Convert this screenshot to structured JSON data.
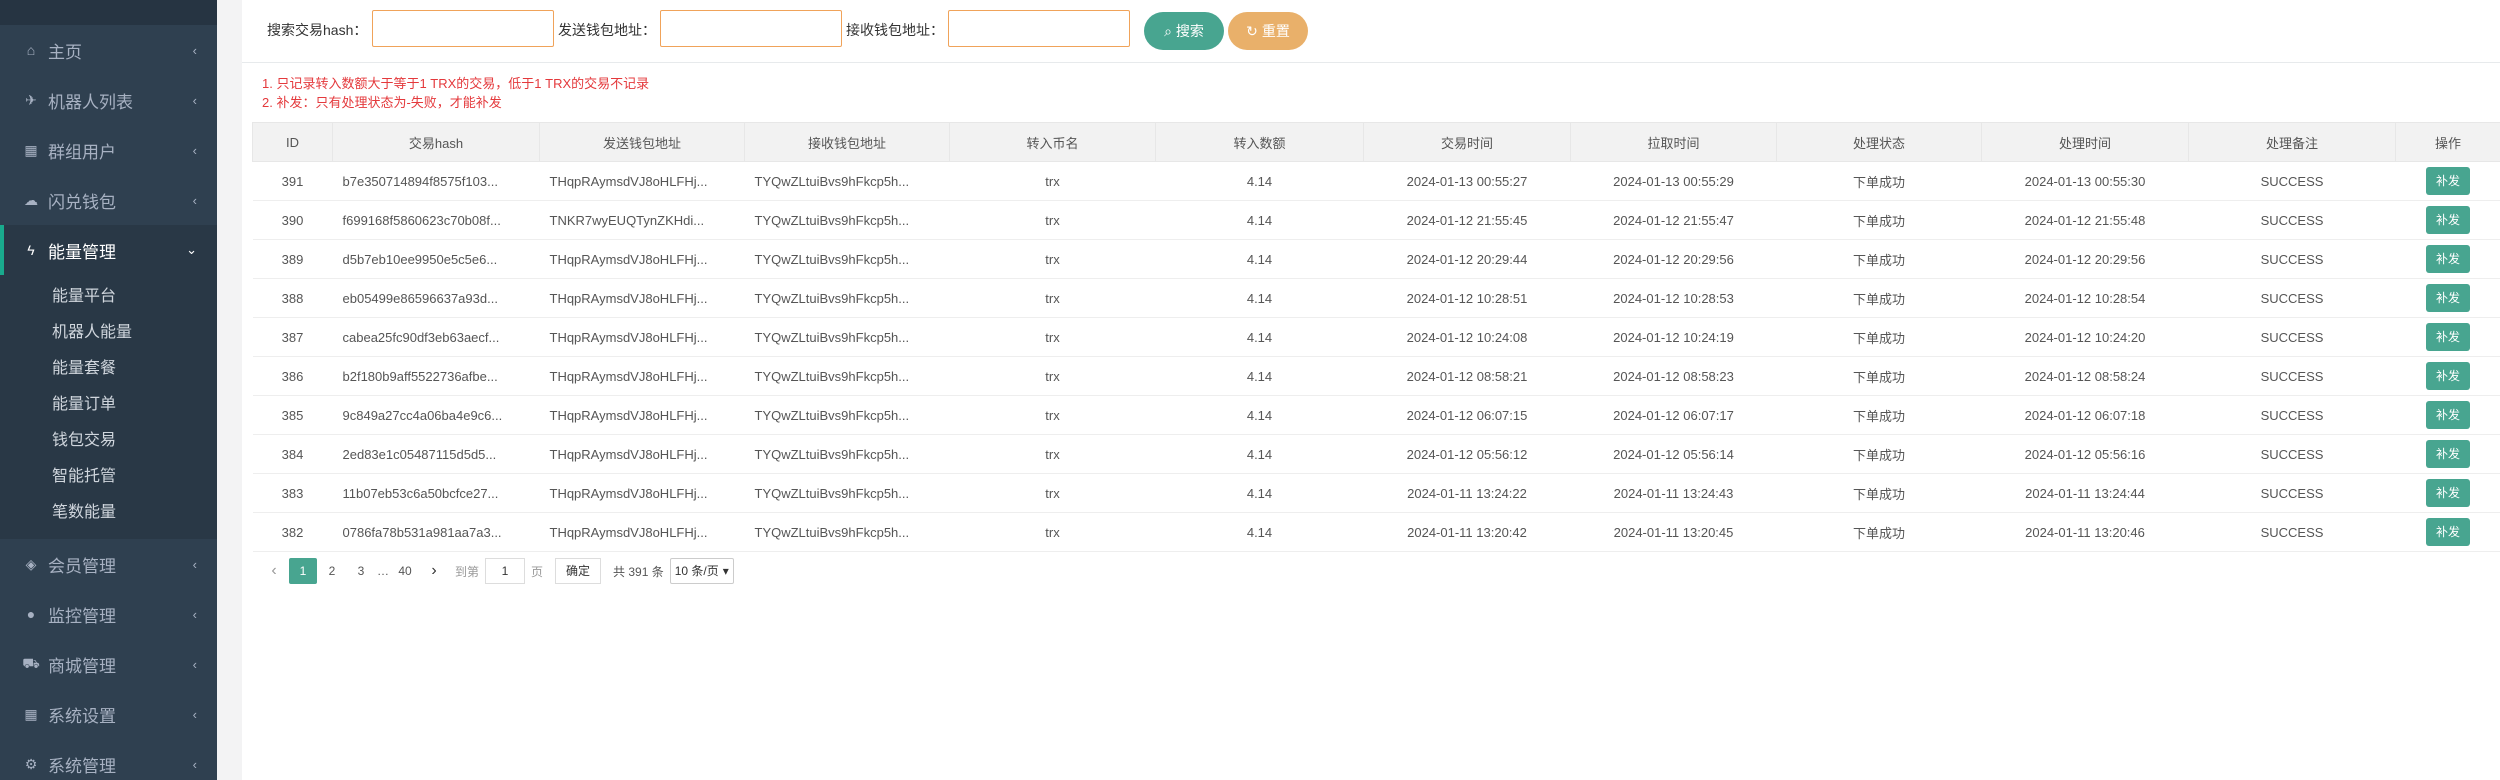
{
  "sidebar": {
    "items": [
      {
        "label": "主页",
        "icon": "home-icon",
        "glyph": "⌂",
        "active": false
      },
      {
        "label": "机器人列表",
        "icon": "plane-icon",
        "glyph": "✈",
        "active": false
      },
      {
        "label": "群组用户",
        "icon": "group-icon",
        "glyph": "▦",
        "active": false
      },
      {
        "label": "闪兑钱包",
        "icon": "cloud-icon",
        "glyph": "☁",
        "active": false
      },
      {
        "label": "能量管理",
        "icon": "bolt-icon",
        "glyph": "ϟ",
        "active": true
      }
    ],
    "sub_items": [
      "能量平台",
      "机器人能量",
      "能量套餐",
      "能量订单",
      "钱包交易",
      "智能托管",
      "笔数能量"
    ],
    "items_after": [
      {
        "label": "会员管理",
        "icon": "diamond-icon",
        "glyph": "◈"
      },
      {
        "label": "监控管理",
        "icon": "shield-icon",
        "glyph": "●"
      },
      {
        "label": "商城管理",
        "icon": "cart-icon",
        "glyph": "⛟"
      },
      {
        "label": "系统设置",
        "icon": "windows-icon",
        "glyph": "▦"
      },
      {
        "label": "系统管理",
        "icon": "gear-icon",
        "glyph": "⚙"
      }
    ]
  },
  "search": {
    "hash_label": "搜索交易hash：",
    "from_label": "发送钱包地址：",
    "to_label": "接收钱包地址：",
    "search_button": "搜索",
    "reset_button": "重置"
  },
  "notes": [
    "1. 只记录转入数额大于等于1 TRX的交易，低于1 TRX的交易不记录",
    "2. 补发：只有处理状态为-失败，才能补发"
  ],
  "table": {
    "headers": [
      "ID",
      "交易hash",
      "发送钱包地址",
      "接收钱包地址",
      "转入币名",
      "转入数额",
      "交易时间",
      "拉取时间",
      "处理状态",
      "处理时间",
      "处理备注",
      "操作"
    ],
    "rows": [
      [
        "391",
        "b7e350714894f8575f103...",
        "THqpRAymsdVJ8oHLFHj...",
        "TYQwZLtuiBvs9hFkcp5h...",
        "trx",
        "4.14",
        "2024-01-13 00:55:27",
        "2024-01-13 00:55:29",
        "下单成功",
        "2024-01-13 00:55:30",
        "SUCCESS",
        "补发"
      ],
      [
        "390",
        "f699168f5860623c70b08f...",
        "TNKR7wyEUQTynZKHdi...",
        "TYQwZLtuiBvs9hFkcp5h...",
        "trx",
        "4.14",
        "2024-01-12 21:55:45",
        "2024-01-12 21:55:47",
        "下单成功",
        "2024-01-12 21:55:48",
        "SUCCESS",
        "补发"
      ],
      [
        "389",
        "d5b7eb10ee9950e5c5e6...",
        "THqpRAymsdVJ8oHLFHj...",
        "TYQwZLtuiBvs9hFkcp5h...",
        "trx",
        "4.14",
        "2024-01-12 20:29:44",
        "2024-01-12 20:29:56",
        "下单成功",
        "2024-01-12 20:29:56",
        "SUCCESS",
        "补发"
      ],
      [
        "388",
        "eb05499e86596637a93d...",
        "THqpRAymsdVJ8oHLFHj...",
        "TYQwZLtuiBvs9hFkcp5h...",
        "trx",
        "4.14",
        "2024-01-12 10:28:51",
        "2024-01-12 10:28:53",
        "下单成功",
        "2024-01-12 10:28:54",
        "SUCCESS",
        "补发"
      ],
      [
        "387",
        "cabea25fc90df3eb63aecf...",
        "THqpRAymsdVJ8oHLFHj...",
        "TYQwZLtuiBvs9hFkcp5h...",
        "trx",
        "4.14",
        "2024-01-12 10:24:08",
        "2024-01-12 10:24:19",
        "下单成功",
        "2024-01-12 10:24:20",
        "SUCCESS",
        "补发"
      ],
      [
        "386",
        "b2f180b9aff5522736afbe...",
        "THqpRAymsdVJ8oHLFHj...",
        "TYQwZLtuiBvs9hFkcp5h...",
        "trx",
        "4.14",
        "2024-01-12 08:58:21",
        "2024-01-12 08:58:23",
        "下单成功",
        "2024-01-12 08:58:24",
        "SUCCESS",
        "补发"
      ],
      [
        "385",
        "9c849a27cc4a06ba4e9c6...",
        "THqpRAymsdVJ8oHLFHj...",
        "TYQwZLtuiBvs9hFkcp5h...",
        "trx",
        "4.14",
        "2024-01-12 06:07:15",
        "2024-01-12 06:07:17",
        "下单成功",
        "2024-01-12 06:07:18",
        "SUCCESS",
        "补发"
      ],
      [
        "384",
        "2ed83e1c05487115d5d5...",
        "THqpRAymsdVJ8oHLFHj...",
        "TYQwZLtuiBvs9hFkcp5h...",
        "trx",
        "4.14",
        "2024-01-12 05:56:12",
        "2024-01-12 05:56:14",
        "下单成功",
        "2024-01-12 05:56:16",
        "SUCCESS",
        "补发"
      ],
      [
        "383",
        "11b07eb53c6a50bcfce27...",
        "THqpRAymsdVJ8oHLFHj...",
        "TYQwZLtuiBvs9hFkcp5h...",
        "trx",
        "4.14",
        "2024-01-11 13:24:22",
        "2024-01-11 13:24:43",
        "下单成功",
        "2024-01-11 13:24:44",
        "SUCCESS",
        "补发"
      ],
      [
        "382",
        "0786fa78b531a981aa7a3...",
        "THqpRAymsdVJ8oHLFHj...",
        "TYQwZLtuiBvs9hFkcp5h...",
        "trx",
        "4.14",
        "2024-01-11 13:20:42",
        "2024-01-11 13:20:45",
        "下单成功",
        "2024-01-11 13:20:46",
        "SUCCESS",
        "补发"
      ]
    ]
  },
  "pagination": {
    "prev": "‹",
    "pages": [
      "1",
      "2",
      "3"
    ],
    "ellipsis": "…",
    "last_page": "40",
    "next": "›",
    "goto_label": "到第",
    "goto_value": "1",
    "page_unit": "页",
    "confirm": "确定",
    "total": "共 391 条",
    "page_size": "10 条/页"
  },
  "colors": {
    "sidebar_bg": "#2f4050",
    "accent": "#48a590",
    "reset": "#e9b06a",
    "note_red": "#e4393c"
  }
}
